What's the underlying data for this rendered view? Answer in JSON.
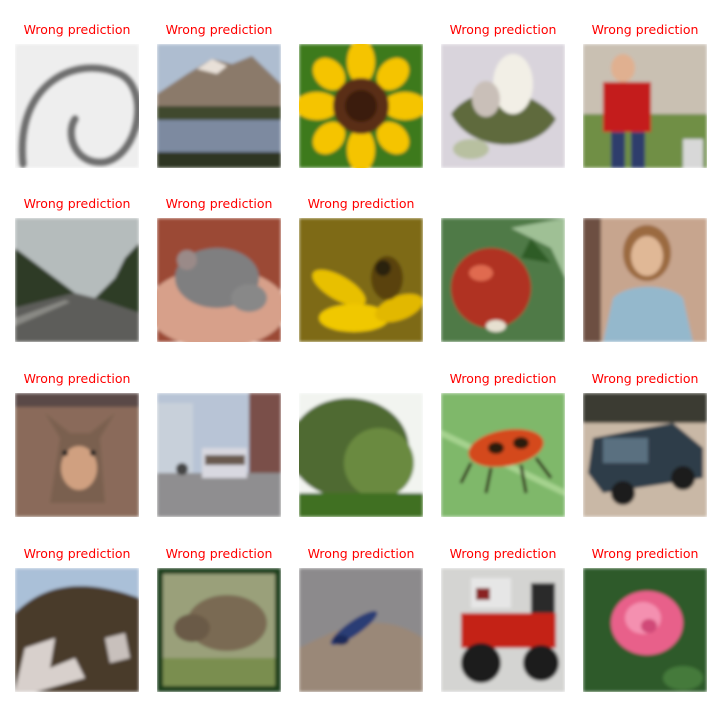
{
  "chart_data": {
    "type": "image_grid",
    "rows": 4,
    "cols": 5,
    "label_color": "#ff0000",
    "panels": [
      {
        "title": "Wrong prediction",
        "scene": "spiral"
      },
      {
        "title": "Wrong prediction",
        "scene": "lake"
      },
      {
        "title": "",
        "scene": "sunflower"
      },
      {
        "title": "Wrong prediction",
        "scene": "white-flower"
      },
      {
        "title": "Wrong prediction",
        "scene": "boy-red-shirt"
      },
      {
        "title": "Wrong prediction",
        "scene": "road-forest"
      },
      {
        "title": "Wrong prediction",
        "scene": "mouse-in-hand"
      },
      {
        "title": "Wrong prediction",
        "scene": "bee-on-flower"
      },
      {
        "title": "",
        "scene": "apple"
      },
      {
        "title": "",
        "scene": "woman"
      },
      {
        "title": "Wrong prediction",
        "scene": "wolf"
      },
      {
        "title": "",
        "scene": "street-bus"
      },
      {
        "title": "",
        "scene": "willow-tree"
      },
      {
        "title": "Wrong prediction",
        "scene": "beetle-on-leaf"
      },
      {
        "title": "Wrong prediction",
        "scene": "pickup-truck"
      },
      {
        "title": "Wrong prediction",
        "scene": "mountain"
      },
      {
        "title": "Wrong prediction",
        "scene": "beaver"
      },
      {
        "title": "Wrong prediction",
        "scene": "lizard"
      },
      {
        "title": "Wrong prediction",
        "scene": "lawn-mower-tractor"
      },
      {
        "title": "Wrong prediction",
        "scene": "pink-rose"
      }
    ]
  }
}
